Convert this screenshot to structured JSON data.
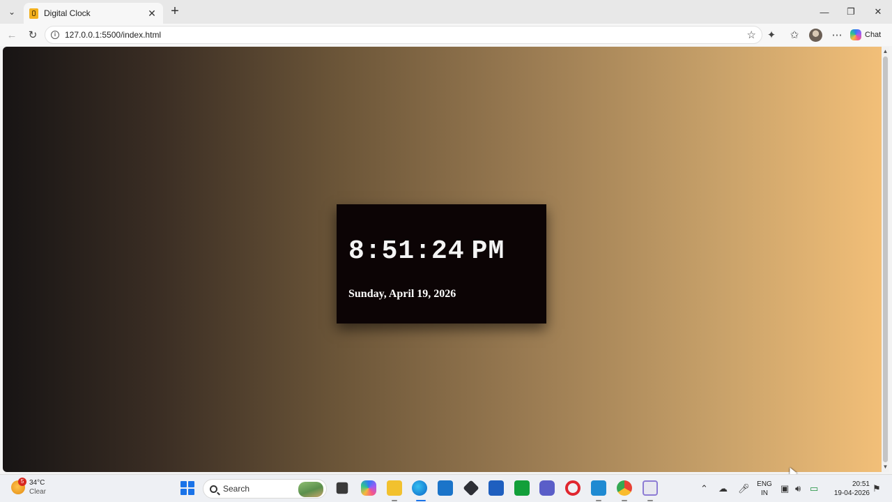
{
  "browser": {
    "tab_title": "Digital Clock",
    "tab_close": "✕",
    "new_tab": "+",
    "url": "127.0.0.1:5500/index.html",
    "chat_label": "Chat"
  },
  "page": {
    "time": "8:51:24",
    "ampm": "PM",
    "date": "Sunday, April 19, 2026"
  },
  "taskbar": {
    "weather_temp": "34°C",
    "weather_desc": "Clear",
    "weather_badge": "5",
    "search_placeholder": "Search",
    "lang_top": "ENG",
    "lang_bottom": "IN",
    "clock_time": "20:51",
    "clock_date": "19-04-2026"
  },
  "colors": {
    "clock_card_bg": "#0c0405",
    "gradient_start": "#171414",
    "gradient_end": "#f2bf78"
  }
}
